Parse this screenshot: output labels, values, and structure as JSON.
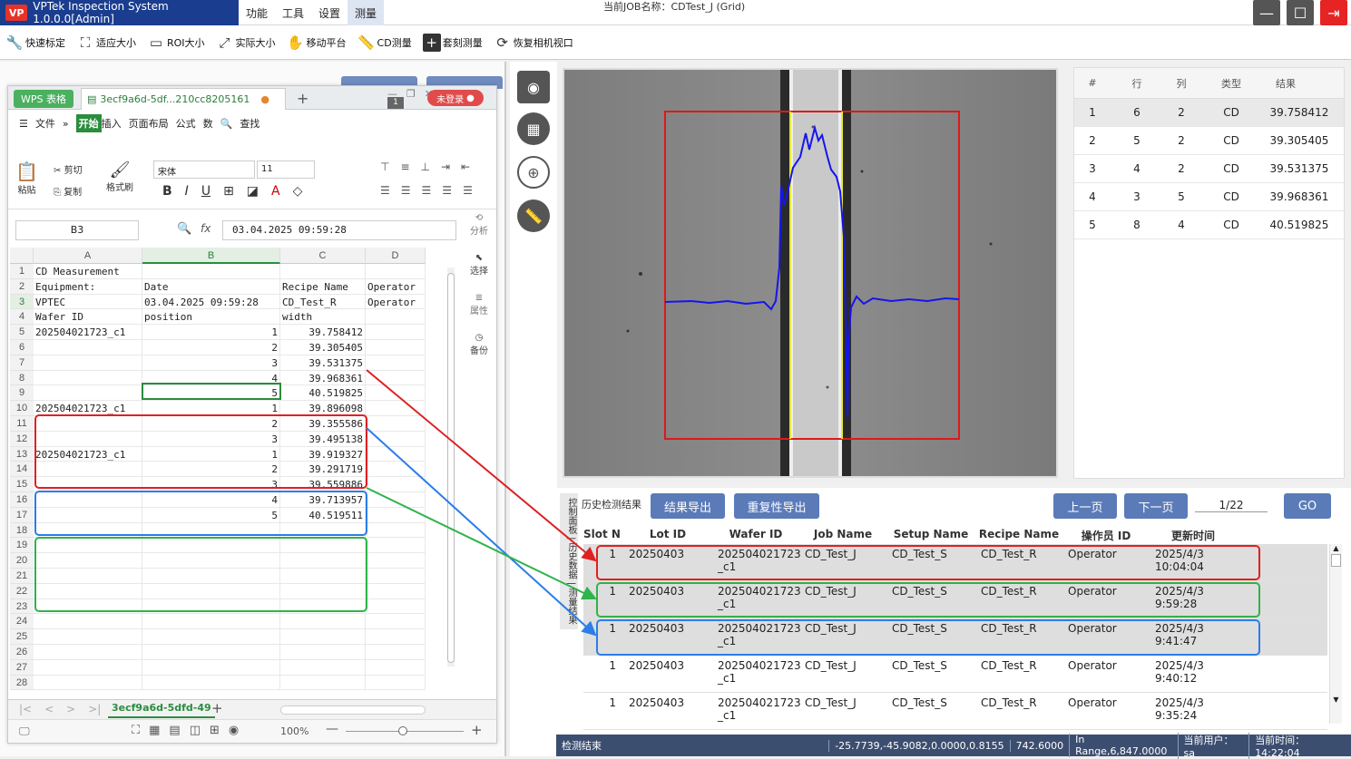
{
  "app": {
    "title": "VPTek Inspection System 1.0.0.0[Admin]",
    "logo": "VP",
    "job_label": "当前JOB名称：CDTest_J (Grid)"
  },
  "menu": [
    "功能",
    "工具",
    "设置",
    "测量"
  ],
  "window_buttons": [
    "minimize-icon",
    "maximize-icon",
    "exit-icon"
  ],
  "toolbar": [
    {
      "icon": "wrench-icon",
      "label": "快速标定"
    },
    {
      "icon": "fit-icon",
      "label": "适应大小"
    },
    {
      "icon": "roi-icon",
      "label": "ROI大小"
    },
    {
      "icon": "actual-size-icon",
      "label": "实际大小"
    },
    {
      "icon": "hand-icon",
      "label": "移动平台"
    },
    {
      "icon": "ruler-icon",
      "label": "CD测量"
    },
    {
      "icon": "plus-icon",
      "label": "套刻测量"
    },
    {
      "icon": "refresh-camera-icon",
      "label": "恢复相机视口"
    }
  ],
  "wps": {
    "badge": "WPS 表格",
    "doc_tab": "3ecf9a6d-5df...210cc8205161",
    "badge_count": "1",
    "login": "未登录",
    "ribbon_menu": [
      "文件",
      "»",
      "开始",
      "插入",
      "页面布局",
      "公式",
      "数"
    ],
    "search": "查找",
    "ribbon_labels": {
      "paste": "粘贴",
      "cut": "剪切",
      "copy": "复制",
      "format_painter": "格式刷"
    },
    "font_name": "宋体",
    "font_size": "11",
    "name_box": "B3",
    "formula": "03.04.2025 09:59:28",
    "side": [
      "分析",
      "选择",
      "属性",
      "备份"
    ],
    "columns": [
      "A",
      "B",
      "C",
      "D"
    ],
    "rows": [
      [
        "CD Measurement",
        "",
        "",
        ""
      ],
      [
        "Equipment:",
        "Date",
        "Recipe Name",
        "Operator"
      ],
      [
        "VPTEC",
        "03.04.2025 09:59:28",
        "CD_Test_R",
        "Operator"
      ],
      [
        "Wafer ID",
        "position",
        "width",
        ""
      ],
      [
        "202504021723_c1",
        "1",
        "39.758412",
        ""
      ],
      [
        "",
        "2",
        "39.305405",
        ""
      ],
      [
        "",
        "3",
        "39.531375",
        ""
      ],
      [
        "",
        "4",
        "39.968361",
        ""
      ],
      [
        "",
        "5",
        "40.519825",
        ""
      ],
      [
        "202504021723_c1",
        "1",
        "39.896098",
        ""
      ],
      [
        "",
        "2",
        "39.355586",
        ""
      ],
      [
        "",
        "3",
        "39.495138",
        ""
      ],
      [
        "202504021723_c1",
        "1",
        "39.919327",
        ""
      ],
      [
        "",
        "2",
        "39.291719",
        ""
      ],
      [
        "",
        "3",
        "39.559886",
        ""
      ],
      [
        "",
        "4",
        "39.713957",
        ""
      ],
      [
        "",
        "5",
        "40.519511",
        ""
      ],
      [
        "",
        "",
        "",
        ""
      ],
      [
        "",
        "",
        "",
        ""
      ],
      [
        "",
        "",
        "",
        ""
      ],
      [
        "",
        "",
        "",
        ""
      ],
      [
        "",
        "",
        "",
        ""
      ],
      [
        "",
        "",
        "",
        ""
      ],
      [
        "",
        "",
        "",
        ""
      ],
      [
        "",
        "",
        "",
        ""
      ],
      [
        "",
        "",
        "",
        ""
      ],
      [
        "",
        "",
        "",
        ""
      ],
      [
        "",
        "",
        "",
        ""
      ]
    ],
    "sheet_tab": "3ecf9a6d-5dfd-49",
    "zoom": "100%"
  },
  "results": {
    "headers": [
      "#",
      "行",
      "列",
      "类型",
      "结果"
    ],
    "rows": [
      [
        "1",
        "6",
        "2",
        "CD",
        "39.758412"
      ],
      [
        "2",
        "5",
        "2",
        "CD",
        "39.305405"
      ],
      [
        "3",
        "4",
        "2",
        "CD",
        "39.531375"
      ],
      [
        "4",
        "3",
        "5",
        "CD",
        "39.968361"
      ],
      [
        "5",
        "8",
        "4",
        "CD",
        "40.519825"
      ]
    ]
  },
  "history": {
    "side_tabs": [
      "控制面板",
      "历史数据",
      "测量结果"
    ],
    "title": "历史检测结果",
    "export_result": "结果导出",
    "export_repeat": "重复性导出",
    "prev": "上一页",
    "next": "下一页",
    "page": "1/22",
    "go": "GO",
    "headers": [
      "Slot N",
      "Lot ID",
      "Wafer ID",
      "Job Name",
      "Setup Name",
      "Recipe Name",
      "操作员 ID",
      "更新时间"
    ],
    "rows": [
      [
        "1",
        "20250403",
        "202504021723\n_c1",
        "CD_Test_J",
        "CD_Test_S",
        "CD_Test_R",
        "Operator",
        "2025/4/3 10:04:04"
      ],
      [
        "1",
        "20250403",
        "202504021723\n_c1",
        "CD_Test_J",
        "CD_Test_S",
        "CD_Test_R",
        "Operator",
        "2025/4/3 9:59:28"
      ],
      [
        "1",
        "20250403",
        "202504021723\n_c1",
        "CD_Test_J",
        "CD_Test_S",
        "CD_Test_R",
        "Operator",
        "2025/4/3 9:41:47"
      ],
      [
        "1",
        "20250403",
        "202504021723\n_c1",
        "CD_Test_J",
        "CD_Test_S",
        "CD_Test_R",
        "Operator",
        "2025/4/3 9:40:12"
      ],
      [
        "1",
        "20250403",
        "202504021723\n_c1",
        "CD_Test_J",
        "CD_Test_S",
        "CD_Test_R",
        "Operator",
        "2025/4/3 9:35:24"
      ]
    ]
  },
  "status": {
    "left": "检测结束",
    "coords": "-25.7739,-45.9082,0.0000,0.8155",
    "value": "742.6000",
    "range": "In Range,6,847.0000",
    "user": "当前用户： sa",
    "time": "当前时间： 14:22:04"
  },
  "colors": {
    "brand": "#1a3d8f",
    "red": "#e02020",
    "blue": "#2b7de9",
    "green": "#2fb34a",
    "button": "#5b7bb8"
  }
}
